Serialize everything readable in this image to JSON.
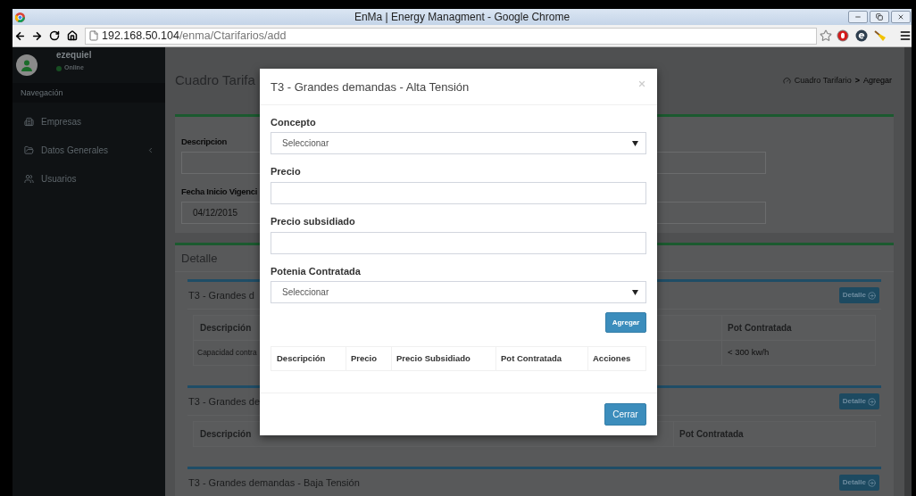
{
  "window": {
    "title": "EnMa | Energy Managment - Google Chrome"
  },
  "browser": {
    "url_host": "192.168.50.104",
    "url_path": "/enma/Ctarifarios/add"
  },
  "sidebar": {
    "user": {
      "name": "ezequiel",
      "status": "Online"
    },
    "header": "Navegación",
    "items": [
      {
        "label": "Empresas",
        "expandable": false
      },
      {
        "label": "Datos Generales",
        "expandable": true
      },
      {
        "label": "Usuarios",
        "expandable": false
      }
    ]
  },
  "page": {
    "title": "Cuadro Tarifa",
    "breadcrumb": {
      "link": "Cuadro Tarifario",
      "separator": ">",
      "current": "Agregar"
    },
    "form": {
      "fields": [
        {
          "label": "Descripcion"
        },
        {
          "label": "Fecha Inicio Vigenci",
          "value": "04/12/2015"
        }
      ]
    },
    "detail": {
      "title": "Detalle",
      "sections": [
        {
          "title": "T3 - Grandes d",
          "button": "Detalle",
          "columns": [
            "Descripción",
            "Pot Contratada"
          ],
          "rows": [
            [
              "Capacidad contra",
              "< 300 kw/h"
            ]
          ]
        },
        {
          "title": "T3 - Grandes de",
          "button": "Detalle",
          "columns": [
            "Descripción",
            "Pot Contratada"
          ]
        },
        {
          "title": "T3 - Grandes demandas - Baja Tensión",
          "button": "Detalle"
        }
      ]
    }
  },
  "modal": {
    "title": "T3 - Grandes demandas - Alta Tensión",
    "fields": [
      {
        "kind": "select",
        "label": "Concepto",
        "value": "Seleccionar"
      },
      {
        "kind": "text",
        "label": "Precio"
      },
      {
        "kind": "text",
        "label": "Precio subsidiado"
      },
      {
        "kind": "select",
        "label": "Potenia Contratada",
        "value": "Seleccionar"
      }
    ],
    "add_button": "Agregar",
    "table": {
      "columns": [
        "Descripción",
        "Precio",
        "Precio Subsidiado",
        "Pot Contratada",
        "Acciones"
      ]
    },
    "close_button": "Cerrar"
  }
}
